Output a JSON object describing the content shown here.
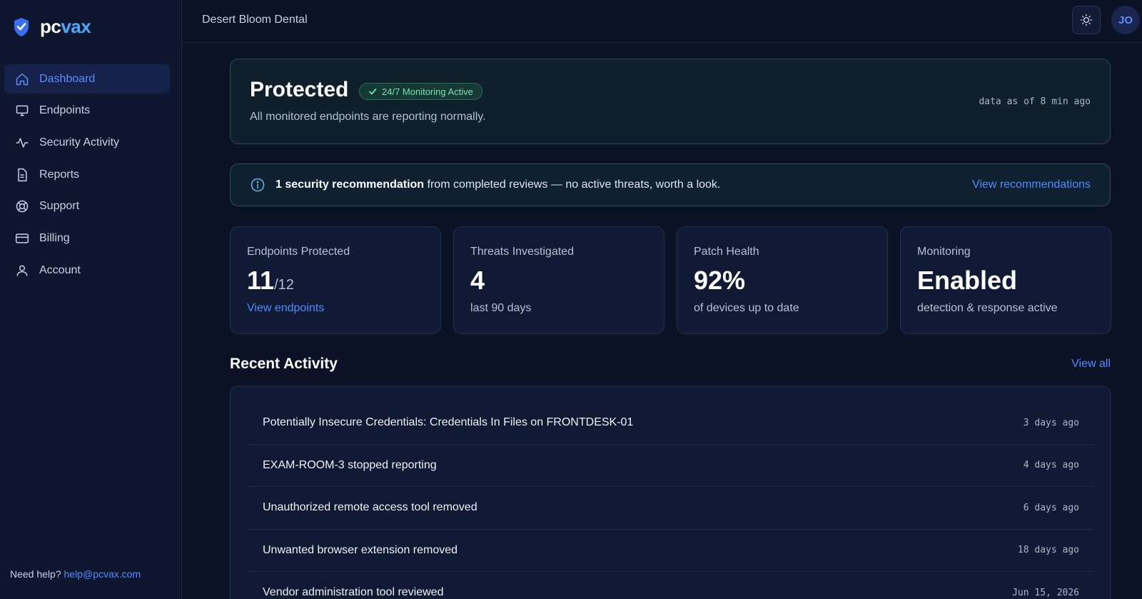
{
  "brand": {
    "prefix": "pc",
    "suffix": "vax"
  },
  "colors": {
    "accent": "#4f8cff",
    "success": "#7be0b6",
    "background": "#0b1226"
  },
  "sidebar": {
    "items": [
      {
        "label": "Dashboard",
        "icon": "home-icon",
        "active": true
      },
      {
        "label": "Endpoints",
        "icon": "monitor-icon"
      },
      {
        "label": "Security Activity",
        "icon": "activity-icon"
      },
      {
        "label": "Reports",
        "icon": "document-icon"
      },
      {
        "label": "Support",
        "icon": "lifebuoy-icon"
      },
      {
        "label": "Billing",
        "icon": "credit-card-icon"
      },
      {
        "label": "Account",
        "icon": "user-icon"
      }
    ],
    "help_text": "Need help?",
    "help_email": "help@pcvax.com"
  },
  "header": {
    "org_name": "Desert Bloom Dental",
    "avatar_initials": "JO",
    "theme_icon": "sun-icon"
  },
  "status": {
    "title": "Protected",
    "badge": "24/7 Monitoring Active",
    "subtitle": "All monitored endpoints are reporting normally.",
    "data_time": "data as of 8 min ago"
  },
  "recommendation": {
    "count_text": "1 security recommendation",
    "rest_text": " from completed reviews — no active threats, worth a look.",
    "link": "View recommendations"
  },
  "stats": [
    {
      "label": "Endpoints Protected",
      "value": "11",
      "value_suffix": "/12",
      "sub": "View endpoints",
      "sub_is_link": true
    },
    {
      "label": "Threats Investigated",
      "value": "4",
      "value_suffix": "",
      "sub": "last 90 days"
    },
    {
      "label": "Patch Health",
      "value": "92%",
      "value_suffix": "",
      "sub": "of devices up to date"
    },
    {
      "label": "Monitoring",
      "value": "Enabled",
      "value_suffix": "",
      "sub": "detection & response active"
    }
  ],
  "activity": {
    "title": "Recent Activity",
    "view_all": "View all",
    "items": [
      {
        "title": "Potentially Insecure Credentials: Credentials In Files on FRONTDESK-01",
        "time": "3 days ago"
      },
      {
        "title": "EXAM-ROOM-3 stopped reporting",
        "time": "4 days ago"
      },
      {
        "title": "Unauthorized remote access tool removed",
        "time": "6 days ago"
      },
      {
        "title": "Unwanted browser extension removed",
        "time": "18 days ago"
      },
      {
        "title": "Vendor administration tool reviewed",
        "time": "Jun 15, 2026"
      }
    ]
  }
}
